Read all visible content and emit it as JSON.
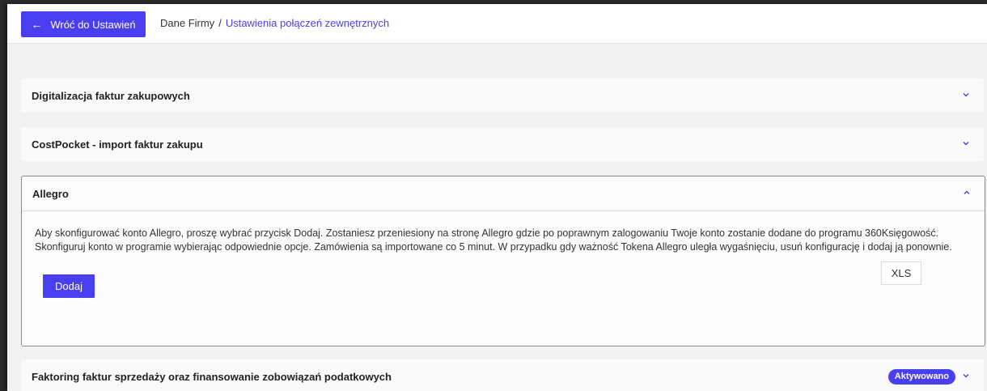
{
  "topbar": {
    "back_label": "Wróć do Ustawień",
    "breadcrumb": {
      "root": "Dane Firmy",
      "separator": "/",
      "current": "Ustawienia połączeń zewnętrznych"
    }
  },
  "panels": [
    {
      "title": "Digitalizacja faktur zakupowych",
      "expanded": false
    },
    {
      "title": "CostPocket - import faktur zakupu",
      "expanded": false
    },
    {
      "title": "Allegro",
      "expanded": true,
      "description_line1": "Aby skonfigurować konto Allegro, proszę wybrać przycisk Dodaj. Zostaniesz przeniesiony na stronę Allegro gdzie po poprawnym zalogowaniu Twoje konto zostanie dodane do programu 360Księgowość.",
      "description_line2": "Skonfiguruj konto w programie wybierając odpowiednie opcje. Zamówienia są importowane co 5 minut. W przypadku gdy ważność Tokena Allegro uległa wygaśnięciu, usuń konfigurację i dodaj ją ponownie.",
      "add_label": "Dodaj",
      "xls_label": "XLS"
    },
    {
      "title": "Faktoring faktur sprzedaży oraz finansowanie zobowiązań podatkowych",
      "expanded": false,
      "badge": "Aktywowano"
    }
  ],
  "colors": {
    "accent": "#4a3ff0",
    "background": "#f2f2f2",
    "panel": "#fafafa"
  },
  "icons": {
    "back": "arrow-left-icon",
    "collapsed": "chevron-down-icon",
    "expanded": "chevron-up-icon"
  }
}
